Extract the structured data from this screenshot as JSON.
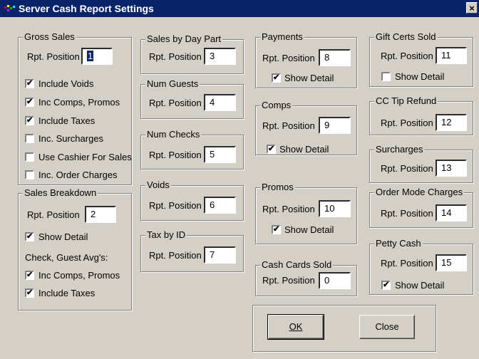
{
  "window": {
    "title": "Server Cash Report Settings",
    "close_label": "×"
  },
  "labels": {
    "rpt_position": "Rpt. Position"
  },
  "gross_sales": {
    "legend": "Gross Sales",
    "position": "1",
    "options": [
      {
        "label": "Include Voids",
        "checked": true
      },
      {
        "label": "Inc Comps, Promos",
        "checked": true
      },
      {
        "label": "Include Taxes",
        "checked": true
      },
      {
        "label": "Inc. Surcharges",
        "checked": false
      },
      {
        "label": "Use Cashier For Sales",
        "checked": false
      },
      {
        "label": "Inc. Order Charges",
        "checked": false
      }
    ]
  },
  "sales_breakdown": {
    "legend": "Sales Breakdown",
    "position": "2",
    "show_detail": {
      "label": "Show Detail",
      "checked": true
    },
    "avg_heading": "Check, Guest Avg's:",
    "options": [
      {
        "label": "Inc Comps, Promos",
        "checked": true
      },
      {
        "label": "Include Taxes",
        "checked": true
      }
    ]
  },
  "sales_by_day_part": {
    "legend": "Sales by Day Part",
    "position": "3"
  },
  "num_guests": {
    "legend": "Num Guests",
    "position": "4"
  },
  "num_checks": {
    "legend": "Num Checks",
    "position": "5"
  },
  "voids": {
    "legend": "Voids",
    "position": "6"
  },
  "tax_by_id": {
    "legend": "Tax by ID",
    "position": "7"
  },
  "payments": {
    "legend": "Payments",
    "position": "8",
    "show_detail": {
      "label": "Show Detail",
      "checked": true
    }
  },
  "comps": {
    "legend": "Comps",
    "position": "9",
    "show_detail": {
      "label": "Show Detail",
      "checked": true
    }
  },
  "promos": {
    "legend": "Promos",
    "position": "10",
    "show_detail": {
      "label": "Show Detail",
      "checked": true
    }
  },
  "cash_cards_sold": {
    "legend": "Cash Cards Sold",
    "position": "0"
  },
  "gift_certs_sold": {
    "legend": "Gift Certs Sold",
    "position": "11",
    "show_detail": {
      "label": "Show Detail",
      "checked": false
    }
  },
  "cc_tip_refund": {
    "legend": "CC Tip Refund",
    "position": "12"
  },
  "surcharges": {
    "legend": "Surcharges",
    "position": "13"
  },
  "order_mode_charges": {
    "legend": "Order Mode Charges",
    "position": "14"
  },
  "petty_cash": {
    "legend": "Petty Cash",
    "position": "15",
    "show_detail": {
      "label": "Show Detail",
      "checked": true
    }
  },
  "buttons": {
    "ok": "OK",
    "close": "Close"
  },
  "check_mark": "✔"
}
